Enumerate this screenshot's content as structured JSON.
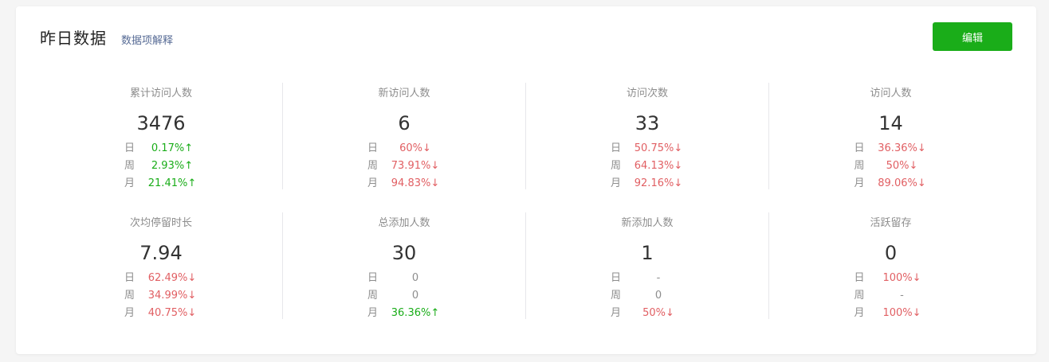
{
  "header": {
    "title": "昨日数据",
    "explain_link": "数据项解释",
    "edit_label": "编辑"
  },
  "periods": {
    "day": "日",
    "week": "周",
    "month": "月"
  },
  "colors": {
    "up": "#1aad19",
    "down": "#e15f63",
    "accent": "#1aad19",
    "link": "#576b95"
  },
  "metrics": [
    {
      "label": "累计访问人数",
      "value": "3476",
      "day": "0.17%↑",
      "day_dir": "up",
      "week": "2.93%↑",
      "week_dir": "up",
      "month": "21.41%↑",
      "month_dir": "up"
    },
    {
      "label": "新访问人数",
      "value": "6",
      "day": "60%↓",
      "day_dir": "down",
      "week": "73.91%↓",
      "week_dir": "down",
      "month": "94.83%↓",
      "month_dir": "down"
    },
    {
      "label": "访问次数",
      "value": "33",
      "day": "50.75%↓",
      "day_dir": "down",
      "week": "64.13%↓",
      "week_dir": "down",
      "month": "92.16%↓",
      "month_dir": "down"
    },
    {
      "label": "访问人数",
      "value": "14",
      "day": "36.36%↓",
      "day_dir": "down",
      "week": "50%↓",
      "week_dir": "down",
      "month": "89.06%↓",
      "month_dir": "down"
    },
    {
      "label": "次均停留时长",
      "value": "7.94",
      "day": "62.49%↓",
      "day_dir": "down",
      "week": "34.99%↓",
      "week_dir": "down",
      "month": "40.75%↓",
      "month_dir": "down"
    },
    {
      "label": "总添加人数",
      "value": "30",
      "day": "0",
      "day_dir": "flat",
      "week": "0",
      "week_dir": "flat",
      "month": "36.36%↑",
      "month_dir": "up"
    },
    {
      "label": "新添加人数",
      "value": "1",
      "day": "-",
      "day_dir": "flat",
      "week": "0",
      "week_dir": "flat",
      "month": "50%↓",
      "month_dir": "down"
    },
    {
      "label": "活跃留存",
      "value": "0",
      "day": "100%↓",
      "day_dir": "down",
      "week": "-",
      "week_dir": "flat",
      "month": "100%↓",
      "month_dir": "down"
    }
  ]
}
